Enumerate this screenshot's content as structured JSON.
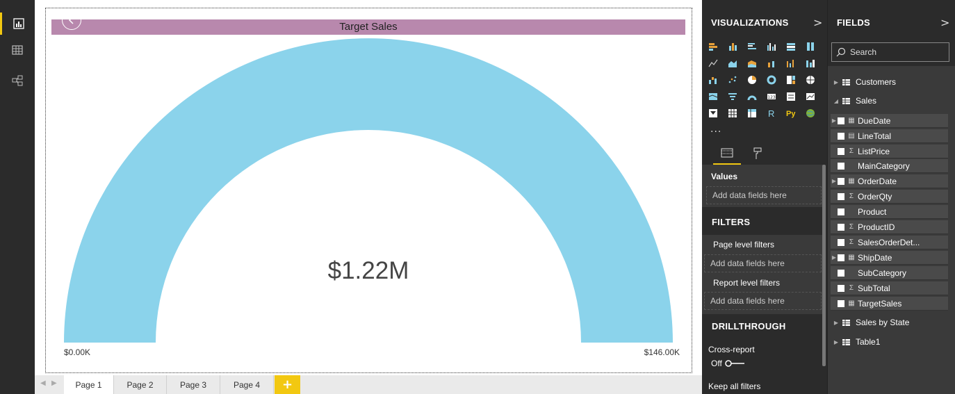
{
  "rail": {
    "icons": [
      "report-view-icon",
      "data-view-icon",
      "model-view-icon"
    ]
  },
  "canvas": {
    "visual_title": "Target Sales",
    "gauge": {
      "value_label": "$1.22M",
      "min_label": "$0.00K",
      "max_label": "$146.00K",
      "fill_color": "#8bd3eb",
      "title_color": "#b888ad"
    }
  },
  "tabs": {
    "pages": [
      "Page 1",
      "Page 2",
      "Page 3",
      "Page 4"
    ],
    "active": "Page 1",
    "add_label": "+"
  },
  "visualizations": {
    "title": "VISUALIZATIONS",
    "more": "...",
    "values_label": "Values",
    "values_placeholder": "Add data fields here",
    "filters_title": "FILTERS",
    "page_filters_label": "Page level filters",
    "page_filters_placeholder": "Add data fields here",
    "report_filters_label": "Report level filters",
    "report_filters_placeholder": "Add data fields here",
    "drillthrough_title": "DRILLTHROUGH",
    "cross_report_label": "Cross-report",
    "cross_report_state": "Off",
    "keep_filters_label": "Keep all filters"
  },
  "fields": {
    "title": "FIELDS",
    "search_placeholder": "Search",
    "tables": [
      {
        "name": "Customers",
        "expanded": false
      },
      {
        "name": "Sales",
        "expanded": true
      },
      {
        "name": "Sales by State",
        "expanded": false
      },
      {
        "name": "Table1",
        "expanded": false
      }
    ],
    "sales_fields": [
      {
        "name": "DueDate",
        "type": "date",
        "expandable": true
      },
      {
        "name": "LineTotal",
        "type": "calc",
        "expandable": false
      },
      {
        "name": "ListPrice",
        "type": "sum",
        "expandable": false
      },
      {
        "name": "MainCategory",
        "type": "text",
        "expandable": false
      },
      {
        "name": "OrderDate",
        "type": "date",
        "expandable": true
      },
      {
        "name": "OrderQty",
        "type": "sum",
        "expandable": false
      },
      {
        "name": "Product",
        "type": "text",
        "expandable": false
      },
      {
        "name": "ProductID",
        "type": "sum",
        "expandable": false
      },
      {
        "name": "SalesOrderDet...",
        "type": "sum",
        "expandable": false
      },
      {
        "name": "ShipDate",
        "type": "date",
        "expandable": true
      },
      {
        "name": "SubCategory",
        "type": "text",
        "expandable": false
      },
      {
        "name": "SubTotal",
        "type": "sum",
        "expandable": false
      },
      {
        "name": "TargetSales",
        "type": "measure",
        "expandable": false
      }
    ]
  }
}
